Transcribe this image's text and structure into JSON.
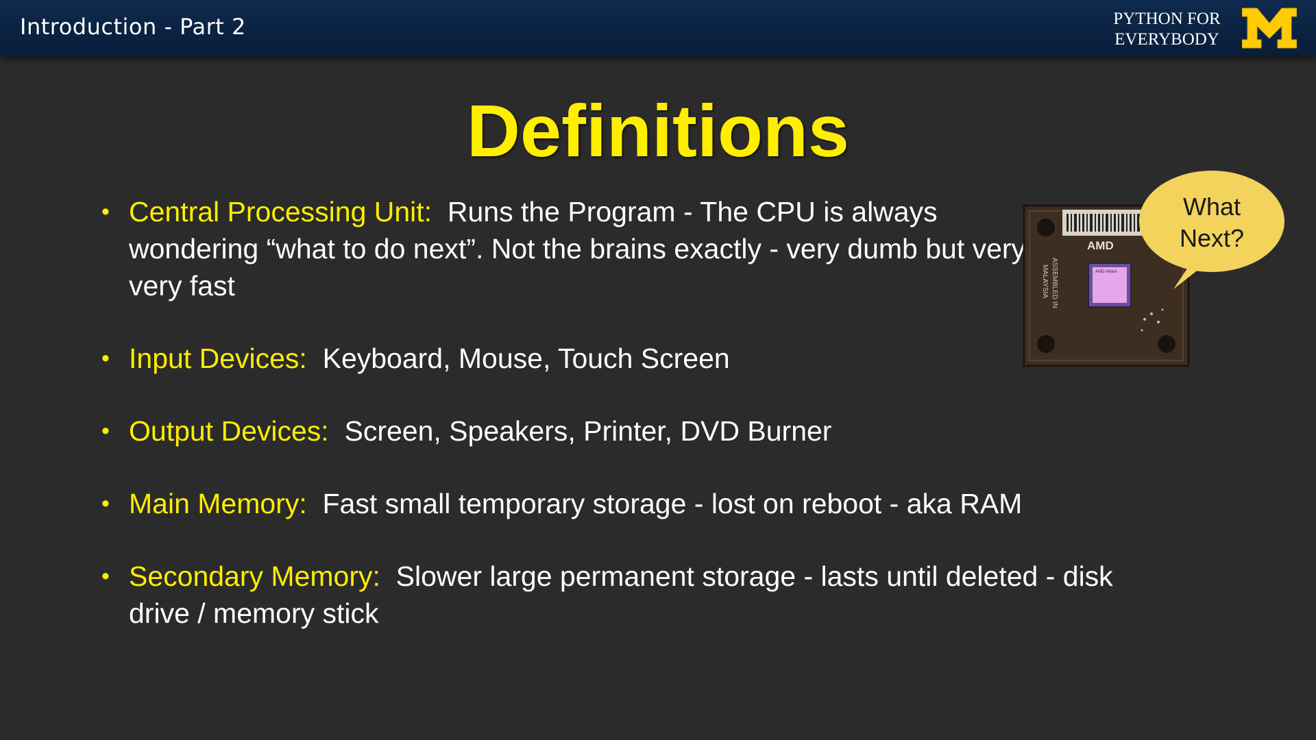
{
  "header": {
    "course_title": "Introduction - Part 2",
    "brand_line1": "PYTHON FOR",
    "brand_line2": "EVERYBODY",
    "logo_letter": "M"
  },
  "slide": {
    "title": "Definitions",
    "bullets": [
      {
        "term": "Central Processing Unit:",
        "text": "Runs the Program - The CPU is always wondering “what to do next”.  Not the brains exactly - very dumb but very very fast"
      },
      {
        "term": "Input Devices:",
        "text": "Keyboard, Mouse, Touch Screen"
      },
      {
        "term": "Output Devices:",
        "text": "Screen, Speakers, Printer, DVD Burner"
      },
      {
        "term": "Main Memory:",
        "text": "Fast small temporary storage - lost on reboot - aka RAM"
      },
      {
        "term": "Secondary Memory:",
        "text": "Slower large permanent storage - lasts until deleted - disk drive / memory stick"
      }
    ],
    "bullet_glyph": "•"
  },
  "cpu_image": {
    "bubble_line1": "What",
    "bubble_line2": "Next?",
    "chip_brand": "AMD",
    "chip_label": "AMD Athlon",
    "side_text1": "ASSEMBLED IN",
    "side_text2": "MALAYSIA"
  },
  "colors": {
    "background": "#2b2b2b",
    "header_bar": "#0f2a4f",
    "accent_yellow": "#ffee00",
    "logo_maize": "#ffcb05",
    "bubble": "#f3d35c"
  }
}
